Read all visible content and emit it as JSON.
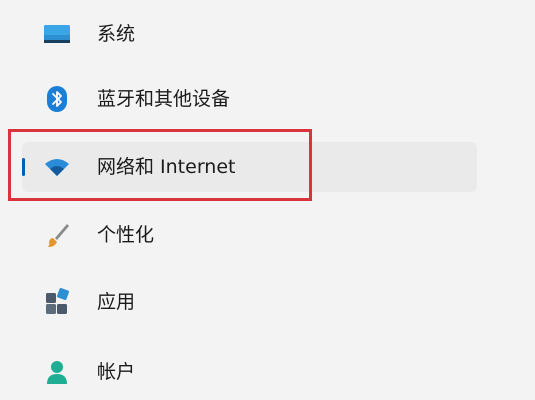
{
  "nav": {
    "items": [
      {
        "label": "系统",
        "icon": "monitor-icon",
        "selected": false
      },
      {
        "label": "蓝牙和其他设备",
        "icon": "bluetooth-icon",
        "selected": false
      },
      {
        "label": "网络和 Internet",
        "icon": "wifi-icon",
        "selected": true
      },
      {
        "label": "个性化",
        "icon": "paintbrush-icon",
        "selected": false
      },
      {
        "label": "应用",
        "icon": "apps-icon",
        "selected": false
      },
      {
        "label": "帐户",
        "icon": "account-icon",
        "selected": false
      }
    ]
  },
  "colors": {
    "accent": "#005fb8",
    "selected_background": "#eaeaea",
    "highlight_border": "#d9343b",
    "page_background": "#f3f3f3"
  }
}
